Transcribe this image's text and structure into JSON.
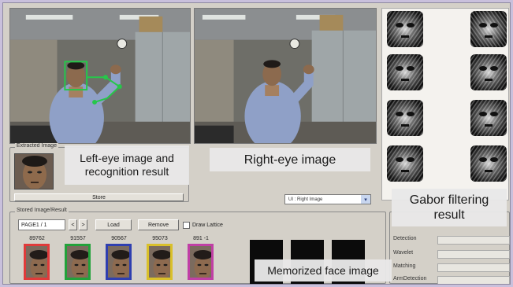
{
  "extracted": {
    "label": "Extracted Image",
    "store_button": "Store"
  },
  "captions": {
    "left_eye_line1": "Left-eye image and",
    "left_eye_line2": "recognition result",
    "right_eye": "Right-eye image",
    "gabor_line1": "Gabor filtering",
    "gabor_line2": "result",
    "memorized": "Memorized face image"
  },
  "right_eye_select": "UI : Right Image",
  "stored": {
    "label": "Stored Image/Result",
    "page": "PAGE1 / 1",
    "prev": "<",
    "next": ">",
    "load": "Load",
    "remove": "Remove",
    "draw_lattice": "Draw Lattice",
    "faces": [
      {
        "score": "89762",
        "color": "#e03a3a"
      },
      {
        "score": "91557",
        "color": "#22a23a"
      },
      {
        "score": "90567",
        "color": "#2f3fb0"
      },
      {
        "score": "95073",
        "color": "#d9c02a"
      },
      {
        "score": "891 -1",
        "color": "#c03fa5"
      }
    ]
  },
  "params": [
    "Detection",
    "Wavelet",
    "Matching",
    "ArmDetection"
  ],
  "colors": {
    "background": "#c9c0dc",
    "window": "#d4d0c8",
    "detection_box": "#26c74a"
  }
}
